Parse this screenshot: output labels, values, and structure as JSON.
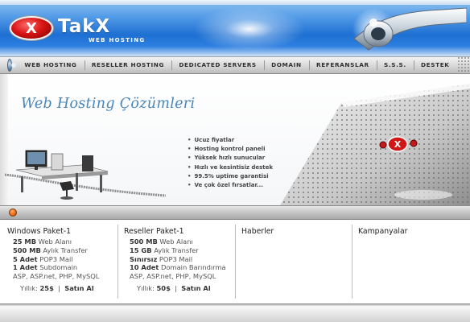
{
  "brand": {
    "logo_mark": "X",
    "name": "TakX",
    "tagline": "WEB HOSTING"
  },
  "nav": {
    "items": [
      "WEB HOSTING",
      "RESELLER HOSTING",
      "DEDICATED SERVERS",
      "DOMAIN",
      "REFERANSLAR",
      "S.S.S.",
      "DESTEK"
    ]
  },
  "banner": {
    "title": "Web Hosting Çözümleri",
    "bullets": [
      "Ucuz fiyatlar",
      "Hosting kontrol paneli",
      "Yüksek hızlı sunucular",
      "Hızlı ve kesintisiz destek",
      "99.5% uptime garantisi",
      "Ve çok özel fırsatlar..."
    ],
    "plate_mark": "X"
  },
  "columns": {
    "windows": {
      "title": "Windows Paket-1",
      "lines": [
        {
          "strong": "25 MB",
          "text": " Web Alanı"
        },
        {
          "strong": "500 MB",
          "text": " Aylık Transfer"
        },
        {
          "strong": "5 Adet",
          "text": " POP3 Mail"
        },
        {
          "strong": "1 Adet",
          "text": " Subdomain"
        },
        {
          "strong": "",
          "text": "ASP, ASP.net, PHP, MySQL"
        }
      ],
      "price_label": "Yıllık:",
      "price": "25$",
      "separator": "|",
      "buy_label": "Satın Al"
    },
    "reseller": {
      "title": "Reseller Paket-1",
      "lines": [
        {
          "strong": "500 MB",
          "text": " Web Alanı"
        },
        {
          "strong": "15 GB",
          "text": " Aylık Transfer"
        },
        {
          "strong": "Sınırsız",
          "text": " POP3 Mail"
        },
        {
          "strong": "10 Adet",
          "text": " Domain Barındırma"
        },
        {
          "strong": "",
          "text": "ASP, ASP.net, PHP, MySQL"
        }
      ],
      "price_label": "Yıllık:",
      "price": "50$",
      "separator": "|",
      "buy_label": "Satın Al"
    },
    "news": {
      "title": "Haberler"
    },
    "campaigns": {
      "title": "Kampanyalar"
    }
  }
}
